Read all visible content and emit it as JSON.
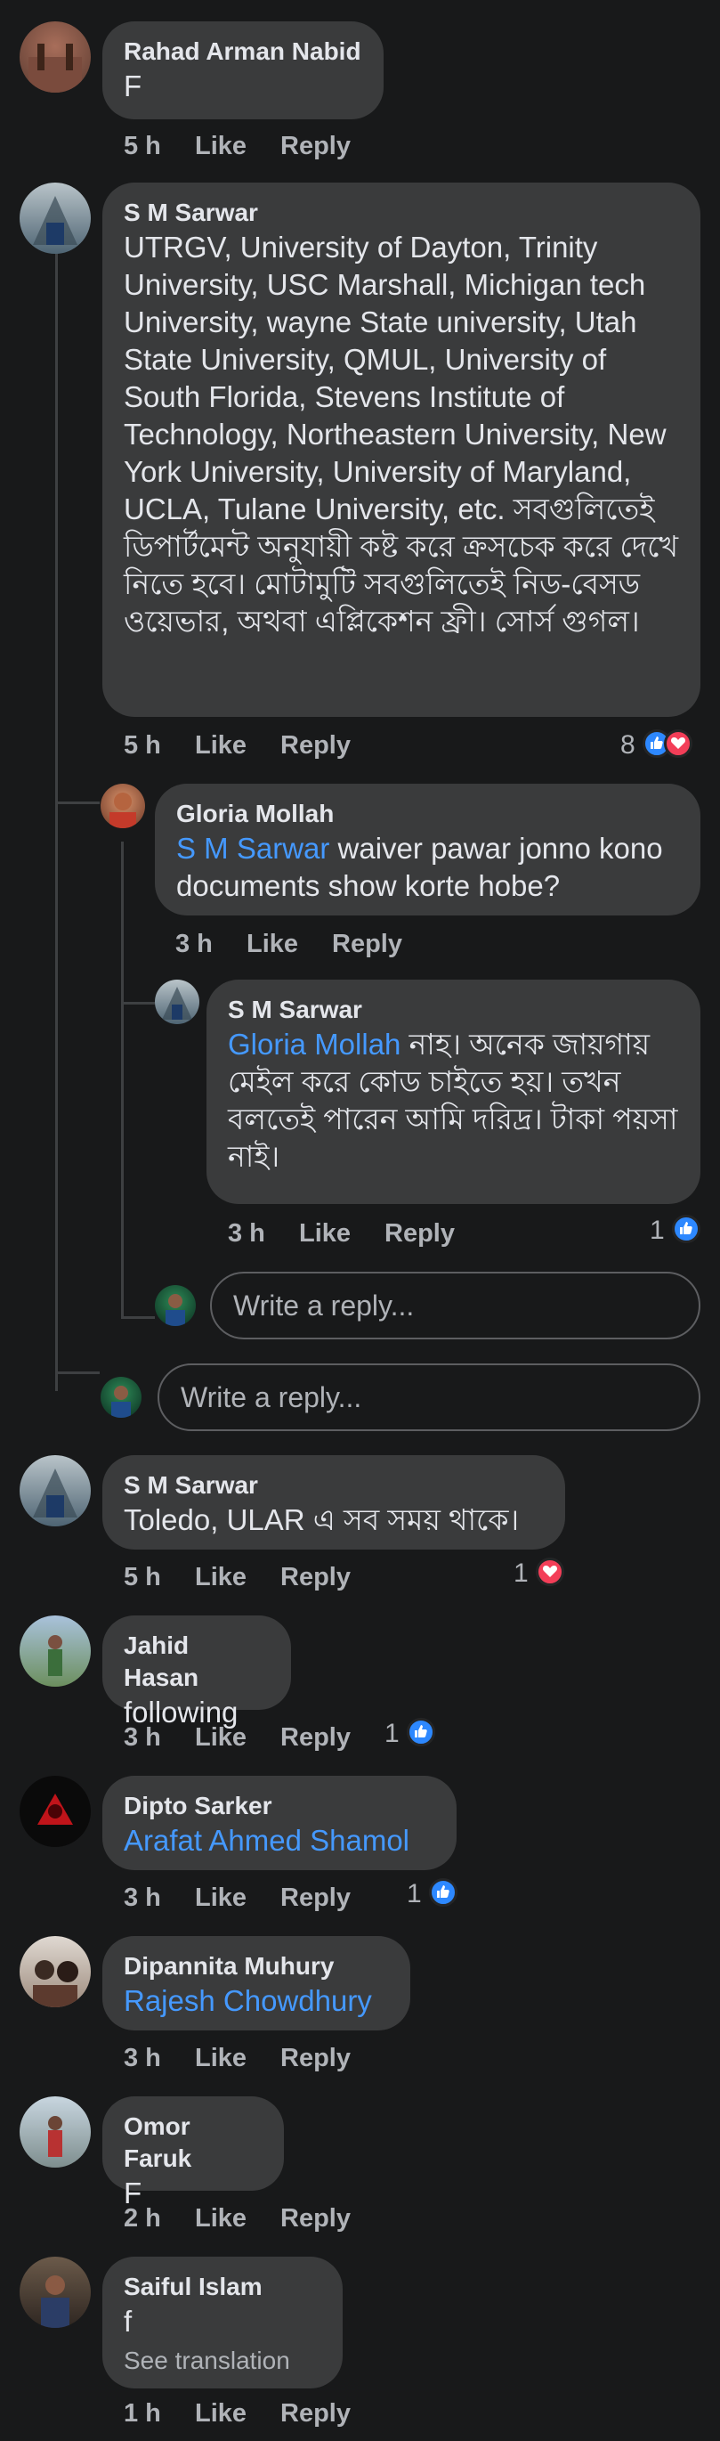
{
  "labels": {
    "like": "Like",
    "reply": "Reply",
    "see_translation": "See translation"
  },
  "comments": [
    {
      "name": "Rahad Arman Nabid",
      "text": "F",
      "time": "5 h"
    },
    {
      "name": "S M Sarwar",
      "text": "UTRGV, University of Dayton, Trinity University, USC Marshall, Michigan tech University, wayne State university, Utah State University, QMUL, University of South Florida, Stevens Institute of Technology, Northeastern University, New York University, University of Maryland, UCLA, Tulane University,  etc. সবগুলিতেই ডিপার্টমেন্ট  অনুযায়ী কষ্ট করে ক্রসচেক করে দেখে নিতে হবে। মোটামুটি সবগুলিতেই নিড-বেসড ওয়েভার, অথবা এপ্লিকেশন ফ্রী। সোর্স গুগল।",
      "time": "5 h",
      "reaction_count": "8",
      "reactions": [
        "like-icon",
        "love-icon"
      ]
    },
    {
      "name": "Gloria Mollah",
      "mention": "S M Sarwar",
      "text": " waiver pawar jonno kono documents show korte hobe?",
      "time": "3 h"
    },
    {
      "name": "S M Sarwar",
      "mention": "Gloria Mollah",
      "text": " নাহ। অনেক জায়গায় মেইল করে কোড চাইতে হয়। তখন বলতেই পারেন আমি দরিদ্র। টাকা পয়সা নাই।",
      "time": "3 h",
      "reaction_count": "1",
      "reactions": [
        "like-icon"
      ]
    },
    {
      "name": "S M Sarwar",
      "text": "Toledo, ULAR এ সব সময় থাকে।",
      "time": "5 h",
      "reaction_count": "1",
      "reactions": [
        "love-icon"
      ]
    },
    {
      "name": "Jahid Hasan",
      "text": "following",
      "time": "3 h",
      "reaction_count": "1",
      "reactions": [
        "like-icon"
      ]
    },
    {
      "name": "Dipto Sarker",
      "mention": "Arafat Ahmed Shamol",
      "time": "3 h",
      "reaction_count": "1",
      "reactions": [
        "like-icon"
      ]
    },
    {
      "name": "Dipannita Muhury",
      "mention": "Rajesh Chowdhury",
      "time": "3 h"
    },
    {
      "name": "Omor Faruk",
      "text": "F",
      "time": "2 h"
    },
    {
      "name": "Saiful Islam",
      "text": "f",
      "time": "1 h"
    }
  ],
  "reply_boxes": {
    "placeholder": "Write a reply..."
  },
  "colors": {
    "background": "#18191a",
    "bubble": "#3a3b3c",
    "mention": "#4599ff",
    "like": "#2d88ff",
    "love": "#f33e58"
  }
}
